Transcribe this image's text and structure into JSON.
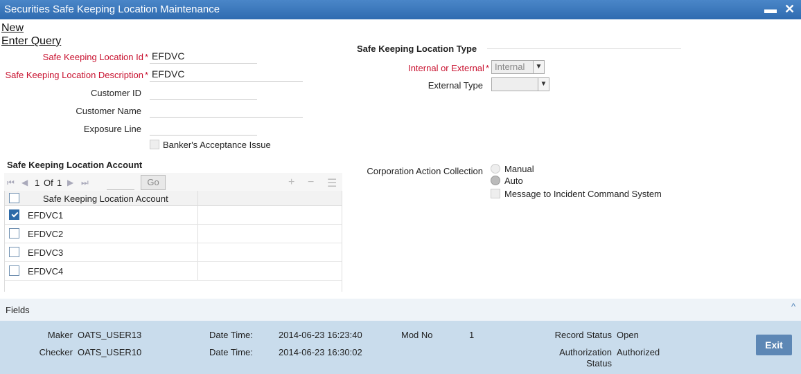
{
  "window": {
    "title": "Securities Safe Keeping Location Maintenance"
  },
  "menu": {
    "new": "New",
    "enter_query": "Enter Query"
  },
  "form": {
    "location_id_label": "Safe Keeping Location Id",
    "location_id_value": "EFDVC",
    "location_desc_label": "Safe Keeping Location Description",
    "location_desc_value": "EFDVC",
    "customer_id_label": "Customer ID",
    "customer_id_value": "",
    "customer_name_label": "Customer Name",
    "customer_name_value": "",
    "exposure_line_label": "Exposure Line",
    "exposure_line_value": "",
    "bankers_acceptance_label": "Banker's Acceptance Issue",
    "required_mark": "*"
  },
  "location_type": {
    "section_title": "Safe Keeping Location Type",
    "internal_external_label": "Internal or External",
    "internal_external_value": "Internal",
    "external_type_label": "External Type",
    "external_type_value": ""
  },
  "corporation_action": {
    "label": "Corporation Action Collection",
    "options": [
      "Manual",
      "Auto"
    ],
    "selected": "Auto",
    "message_label": "Message to Incident Command System"
  },
  "account_grid": {
    "section_title": "Safe Keeping Location Account",
    "page_current": "1",
    "page_of": "Of",
    "page_total": "1",
    "go_label": "Go",
    "column_header": "Safe Keeping Location Account",
    "rows": [
      {
        "value": "EFDVC1",
        "checked": true
      },
      {
        "value": "EFDVC2",
        "checked": false
      },
      {
        "value": "EFDVC3",
        "checked": false
      },
      {
        "value": "EFDVC4",
        "checked": false
      }
    ]
  },
  "fields_bar": {
    "label": "Fields"
  },
  "footer": {
    "maker_label": "Maker",
    "maker_value": "OATS_USER13",
    "checker_label": "Checker",
    "checker_value": "OATS_USER10",
    "datetime_label_1": "Date Time:",
    "datetime_value_1": "2014-06-23 16:23:40",
    "datetime_label_2": "Date Time:",
    "datetime_value_2": "2014-06-23 16:30:02",
    "mod_no_label": "Mod No",
    "mod_no_value": "1",
    "record_status_label": "Record Status",
    "record_status_value": "Open",
    "auth_status_label_1": "Authorization",
    "auth_status_label_2": "Status",
    "auth_status_value": "Authorized",
    "exit_label": "Exit"
  },
  "colors": {
    "titlebar": "#2f6bb0",
    "required": "#c8102e",
    "footer_bg": "#c9dcec",
    "exit_button": "#5d87b5"
  }
}
